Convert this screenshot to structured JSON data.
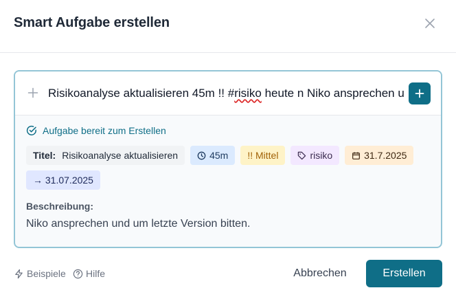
{
  "dialog": {
    "title": "Smart Aufgabe erstellen",
    "close_icon": "close-icon"
  },
  "input": {
    "value_before": "Risikoanalyse aktualisieren 45m !! #",
    "value_misspelled": "risiko",
    "value_after": " heute n Niko ansprechen und um letzte Version bitten.",
    "add_icon": "plus-icon"
  },
  "status": {
    "text": "Aufgabe bereit zum Erstellen",
    "icon": "check-circle-icon",
    "color": "#0f6e87"
  },
  "chips": {
    "title_label": "Titel:",
    "title_value": "Risikoanalyse aktualisieren",
    "duration": "45m",
    "priority": "!! Mittel",
    "tag": "risiko",
    "date": "31.7.2025",
    "due": "→ 31.07.2025"
  },
  "description": {
    "label": "Beschreibung:",
    "text": "Niko ansprechen und um letzte Version bitten."
  },
  "footer": {
    "examples": "Beispiele",
    "help": "Hilfe",
    "cancel": "Abbrechen",
    "create": "Erstellen"
  },
  "colors": {
    "accent": "#0f6e87",
    "panel_border": "#93c5d6"
  }
}
